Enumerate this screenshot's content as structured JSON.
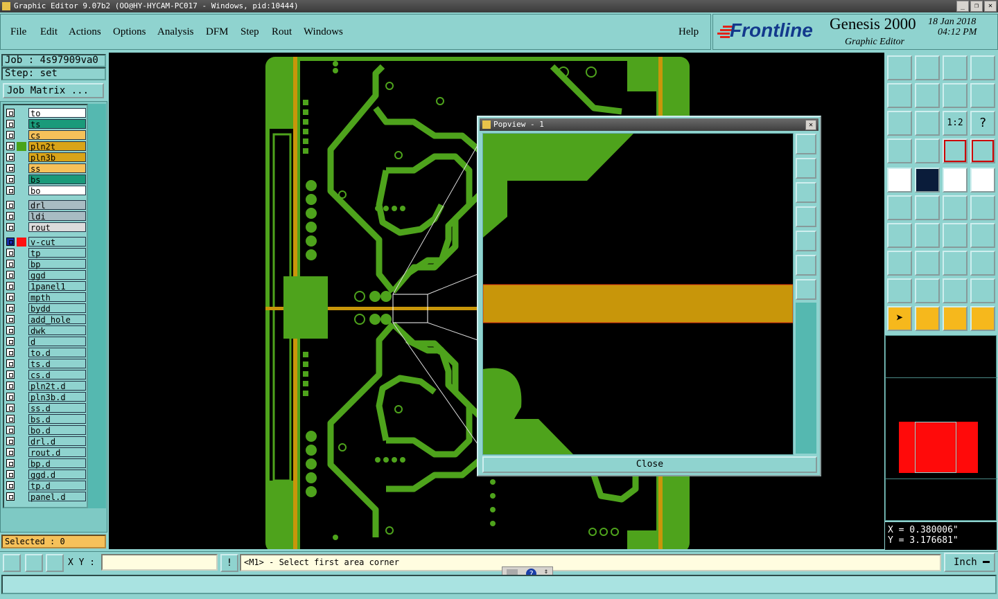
{
  "window": {
    "title": "Graphic Editor 9.07b2 (OO@HY-HYCAM-PC017 - Windows, pid:10444)"
  },
  "menu": [
    "File",
    "Edit",
    "Actions",
    "Options",
    "Analysis",
    "DFM",
    "Step",
    "Rout",
    "Windows"
  ],
  "help_label": "Help",
  "brand": {
    "logo": "Frontline",
    "product": "Genesis 2000",
    "subtitle": "Graphic Editor",
    "date": "18 Jan 2018",
    "time": "04:12 PM"
  },
  "job": {
    "job_label": "Job : 4s97909va0",
    "step_label": "Step: set",
    "matrix_button": "Job Matrix ..."
  },
  "layers": [
    {
      "name": "to",
      "color": "#ffffff"
    },
    {
      "name": "ts",
      "color": "#1a9a7a"
    },
    {
      "name": "cs",
      "color": "#f6c15a"
    },
    {
      "name": "pln2t",
      "color": "#d9a418",
      "swatch": "#49a319"
    },
    {
      "name": "pln3b",
      "color": "#d9a418"
    },
    {
      "name": "ss",
      "color": "#f6c15a"
    },
    {
      "name": "bs",
      "color": "#1a9a7a"
    },
    {
      "name": "bo",
      "color": "#ffffff"
    },
    {
      "name": "drl",
      "color": "#a8bcc3"
    },
    {
      "name": "ldi",
      "color": "#a8bcc3"
    },
    {
      "name": "rout",
      "color": "#dcdcdc"
    },
    {
      "name": "v-cut",
      "color": "#8fd3cf",
      "swatch": "#ff1010",
      "active": true
    },
    {
      "name": "tp",
      "color": "#8fd3cf"
    },
    {
      "name": "bp",
      "color": "#8fd3cf"
    },
    {
      "name": "ggd",
      "color": "#8fd3cf"
    },
    {
      "name": "1panel1",
      "color": "#8fd3cf"
    },
    {
      "name": "mpth",
      "color": "#8fd3cf"
    },
    {
      "name": "bydd",
      "color": "#8fd3cf"
    },
    {
      "name": "add_hole",
      "color": "#8fd3cf"
    },
    {
      "name": "dwk",
      "color": "#8fd3cf"
    },
    {
      "name": "d",
      "color": "#8fd3cf"
    },
    {
      "name": "to.d",
      "color": "#8fd3cf"
    },
    {
      "name": "ts.d",
      "color": "#8fd3cf"
    },
    {
      "name": "cs.d",
      "color": "#8fd3cf"
    },
    {
      "name": "pln2t.d",
      "color": "#8fd3cf"
    },
    {
      "name": "pln3b.d",
      "color": "#8fd3cf"
    },
    {
      "name": "ss.d",
      "color": "#8fd3cf"
    },
    {
      "name": "bs.d",
      "color": "#8fd3cf"
    },
    {
      "name": "bo.d",
      "color": "#8fd3cf"
    },
    {
      "name": "drl.d",
      "color": "#8fd3cf"
    },
    {
      "name": "rout.d",
      "color": "#8fd3cf"
    },
    {
      "name": "bp.d",
      "color": "#8fd3cf"
    },
    {
      "name": "ggd.d",
      "color": "#8fd3cf"
    },
    {
      "name": "tp.d",
      "color": "#8fd3cf"
    },
    {
      "name": "panel.d",
      "color": "#8fd3cf"
    }
  ],
  "selected_label": "Selected : 0",
  "popview": {
    "title": "Popview - 1",
    "close_button": "Close"
  },
  "coords": {
    "x": "X = 0.380006\"",
    "y": "Y = 3.176681\""
  },
  "bottom": {
    "xy_label": "X Y :",
    "xy_input": "",
    "prompt": "<M1> - Select first area corner",
    "units": "Inch"
  },
  "colors": {
    "copper": "#4ea31c",
    "gold": "#c8960a",
    "panel_bg": "#8fd3cf"
  }
}
